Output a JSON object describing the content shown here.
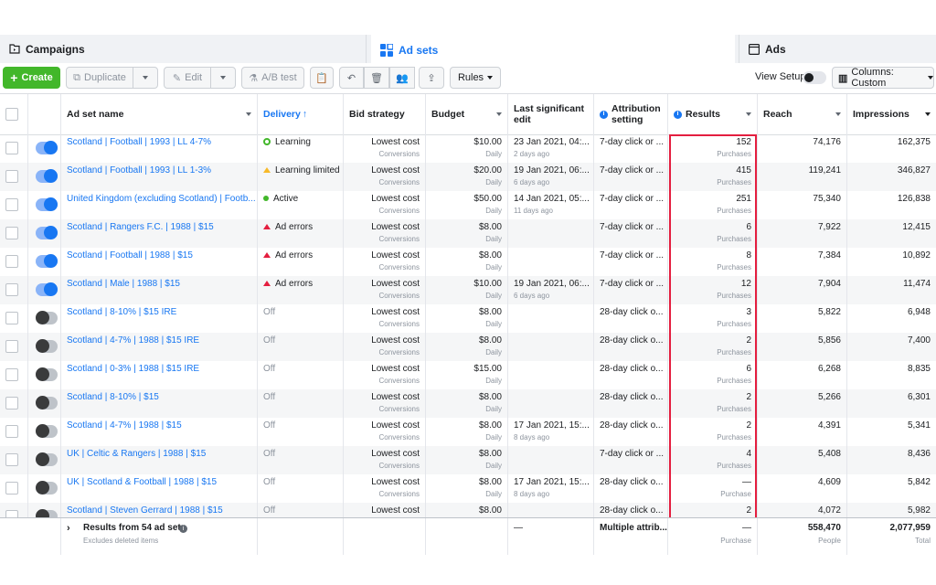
{
  "tabs": {
    "campaigns": "Campaigns",
    "adsets": "Ad sets",
    "ads": "Ads"
  },
  "toolbar": {
    "create": "Create",
    "duplicate": "Duplicate",
    "edit": "Edit",
    "ab_test": "A/B test",
    "rules": "Rules",
    "view_setup": "View Setup",
    "columns": "Columns: Custom"
  },
  "headers": {
    "name": "Ad set name",
    "delivery": "Delivery",
    "bid": "Bid strategy",
    "budget": "Budget",
    "last_edit": "Last significant edit",
    "attribution": "Attribution setting",
    "results": "Results",
    "reach": "Reach",
    "impressions": "Impressions"
  },
  "rows": [
    {
      "name": "Scotland | Football | 1993 | LL 4-7%",
      "on": true,
      "delivery": "Learning",
      "status": "learning",
      "bid": "Lowest cost",
      "bid_sub": "Conversions",
      "budget": "$10.00",
      "budget_sub": "Daily",
      "edit": "23 Jan 2021, 04:...",
      "edit_sub": "2 days ago",
      "attr": "7-day click or ...",
      "results": "152",
      "results_sub": "Purchases",
      "reach": "74,176",
      "impressions": "162,375"
    },
    {
      "name": "Scotland | Football | 1993 | LL 1-3%",
      "on": true,
      "delivery": "Learning limited",
      "status": "limited",
      "bid": "Lowest cost",
      "bid_sub": "Conversions",
      "budget": "$20.00",
      "budget_sub": "Daily",
      "edit": "19 Jan 2021, 06:...",
      "edit_sub": "6 days ago",
      "attr": "7-day click or ...",
      "results": "415",
      "results_sub": "Purchases",
      "reach": "119,241",
      "impressions": "346,827"
    },
    {
      "name": "United Kingdom (excluding Scotland) | Footb...",
      "on": true,
      "delivery": "Active",
      "status": "active",
      "bid": "Lowest cost",
      "bid_sub": "Conversions",
      "budget": "$50.00",
      "budget_sub": "Daily",
      "edit": "14 Jan 2021, 05:...",
      "edit_sub": "11 days ago",
      "attr": "7-day click or ...",
      "results": "251",
      "results_sub": "Purchases",
      "reach": "75,340",
      "impressions": "126,838"
    },
    {
      "name": "Scotland | Rangers F.C. | 1988 | $15",
      "on": true,
      "delivery": "Ad errors",
      "status": "error",
      "bid": "Lowest cost",
      "bid_sub": "Conversions",
      "budget": "$8.00",
      "budget_sub": "Daily",
      "edit": "",
      "edit_sub": "",
      "attr": "7-day click or ...",
      "results": "6",
      "results_sub": "Purchases",
      "reach": "7,922",
      "impressions": "12,415"
    },
    {
      "name": "Scotland | Football | 1988 | $15",
      "on": true,
      "delivery": "Ad errors",
      "status": "error",
      "bid": "Lowest cost",
      "bid_sub": "Conversions",
      "budget": "$8.00",
      "budget_sub": "Daily",
      "edit": "",
      "edit_sub": "",
      "attr": "7-day click or ...",
      "results": "8",
      "results_sub": "Purchases",
      "reach": "7,384",
      "impressions": "10,892"
    },
    {
      "name": "Scotland | Male | 1988 | $15",
      "on": true,
      "delivery": "Ad errors",
      "status": "error",
      "bid": "Lowest cost",
      "bid_sub": "Conversions",
      "budget": "$10.00",
      "budget_sub": "Daily",
      "edit": "19 Jan 2021, 06:...",
      "edit_sub": "6 days ago",
      "attr": "7-day click or ...",
      "results": "12",
      "results_sub": "Purchases",
      "reach": "7,904",
      "impressions": "11,474"
    },
    {
      "name": "Scotland | 8-10% | $15 IRE",
      "on": false,
      "delivery": "Off",
      "status": "off",
      "bid": "Lowest cost",
      "bid_sub": "Conversions",
      "budget": "$8.00",
      "budget_sub": "Daily",
      "edit": "",
      "edit_sub": "",
      "attr": "28-day click o...",
      "results": "3",
      "results_sub": "Purchases",
      "reach": "5,822",
      "impressions": "6,948"
    },
    {
      "name": "Scotland | 4-7% | 1988 | $15 IRE",
      "on": false,
      "delivery": "Off",
      "status": "off",
      "bid": "Lowest cost",
      "bid_sub": "Conversions",
      "budget": "$8.00",
      "budget_sub": "Daily",
      "edit": "",
      "edit_sub": "",
      "attr": "28-day click o...",
      "results": "2",
      "results_sub": "Purchases",
      "reach": "5,856",
      "impressions": "7,400"
    },
    {
      "name": "Scotland | 0-3% | 1988 | $15 IRE",
      "on": false,
      "delivery": "Off",
      "status": "off",
      "bid": "Lowest cost",
      "bid_sub": "Conversions",
      "budget": "$15.00",
      "budget_sub": "Daily",
      "edit": "",
      "edit_sub": "",
      "attr": "28-day click o...",
      "results": "6",
      "results_sub": "Purchases",
      "reach": "6,268",
      "impressions": "8,835"
    },
    {
      "name": "Scotland | 8-10% | $15",
      "on": false,
      "delivery": "Off",
      "status": "off",
      "bid": "Lowest cost",
      "bid_sub": "Conversions",
      "budget": "$8.00",
      "budget_sub": "Daily",
      "edit": "",
      "edit_sub": "",
      "attr": "28-day click o...",
      "results": "2",
      "results_sub": "Purchases",
      "reach": "5,266",
      "impressions": "6,301"
    },
    {
      "name": "Scotland | 4-7% | 1988 | $15",
      "on": false,
      "delivery": "Off",
      "status": "off",
      "bid": "Lowest cost",
      "bid_sub": "Conversions",
      "budget": "$8.00",
      "budget_sub": "Daily",
      "edit": "17 Jan 2021, 15:...",
      "edit_sub": "8 days ago",
      "attr": "28-day click o...",
      "results": "2",
      "results_sub": "Purchases",
      "reach": "4,391",
      "impressions": "5,341"
    },
    {
      "name": "UK | Celtic & Rangers | 1988 | $15",
      "on": false,
      "delivery": "Off",
      "status": "off",
      "bid": "Lowest cost",
      "bid_sub": "Conversions",
      "budget": "$8.00",
      "budget_sub": "Daily",
      "edit": "",
      "edit_sub": "",
      "attr": "7-day click or ...",
      "results": "4",
      "results_sub": "Purchases",
      "reach": "5,408",
      "impressions": "8,436"
    },
    {
      "name": "UK | Scotland & Football | 1988 | $15",
      "on": false,
      "delivery": "Off",
      "status": "off",
      "bid": "Lowest cost",
      "bid_sub": "Conversions",
      "budget": "$8.00",
      "budget_sub": "Daily",
      "edit": "17 Jan 2021, 15:...",
      "edit_sub": "8 days ago",
      "attr": "28-day click o...",
      "results": "—",
      "results_sub": "Purchase",
      "reach": "4,609",
      "impressions": "5,842"
    },
    {
      "name": "Scotland | Steven Gerrard | 1988 | $15",
      "on": false,
      "delivery": "Off",
      "status": "off",
      "bid": "Lowest cost",
      "bid_sub": "",
      "budget": "$8.00",
      "budget_sub": "",
      "edit": "",
      "edit_sub": "",
      "attr": "28-day click o...",
      "results": "2",
      "results_sub": "",
      "reach": "4,072",
      "impressions": "5,982"
    }
  ],
  "footer": {
    "label": "Results from 54 ad sets",
    "sub": "Excludes deleted items",
    "edit": "—",
    "attr": "Multiple attrib...",
    "results": "—",
    "results_sub": "Purchase",
    "reach": "558,470",
    "reach_sub": "People",
    "impressions": "2,077,959",
    "impressions_sub": "Total"
  }
}
